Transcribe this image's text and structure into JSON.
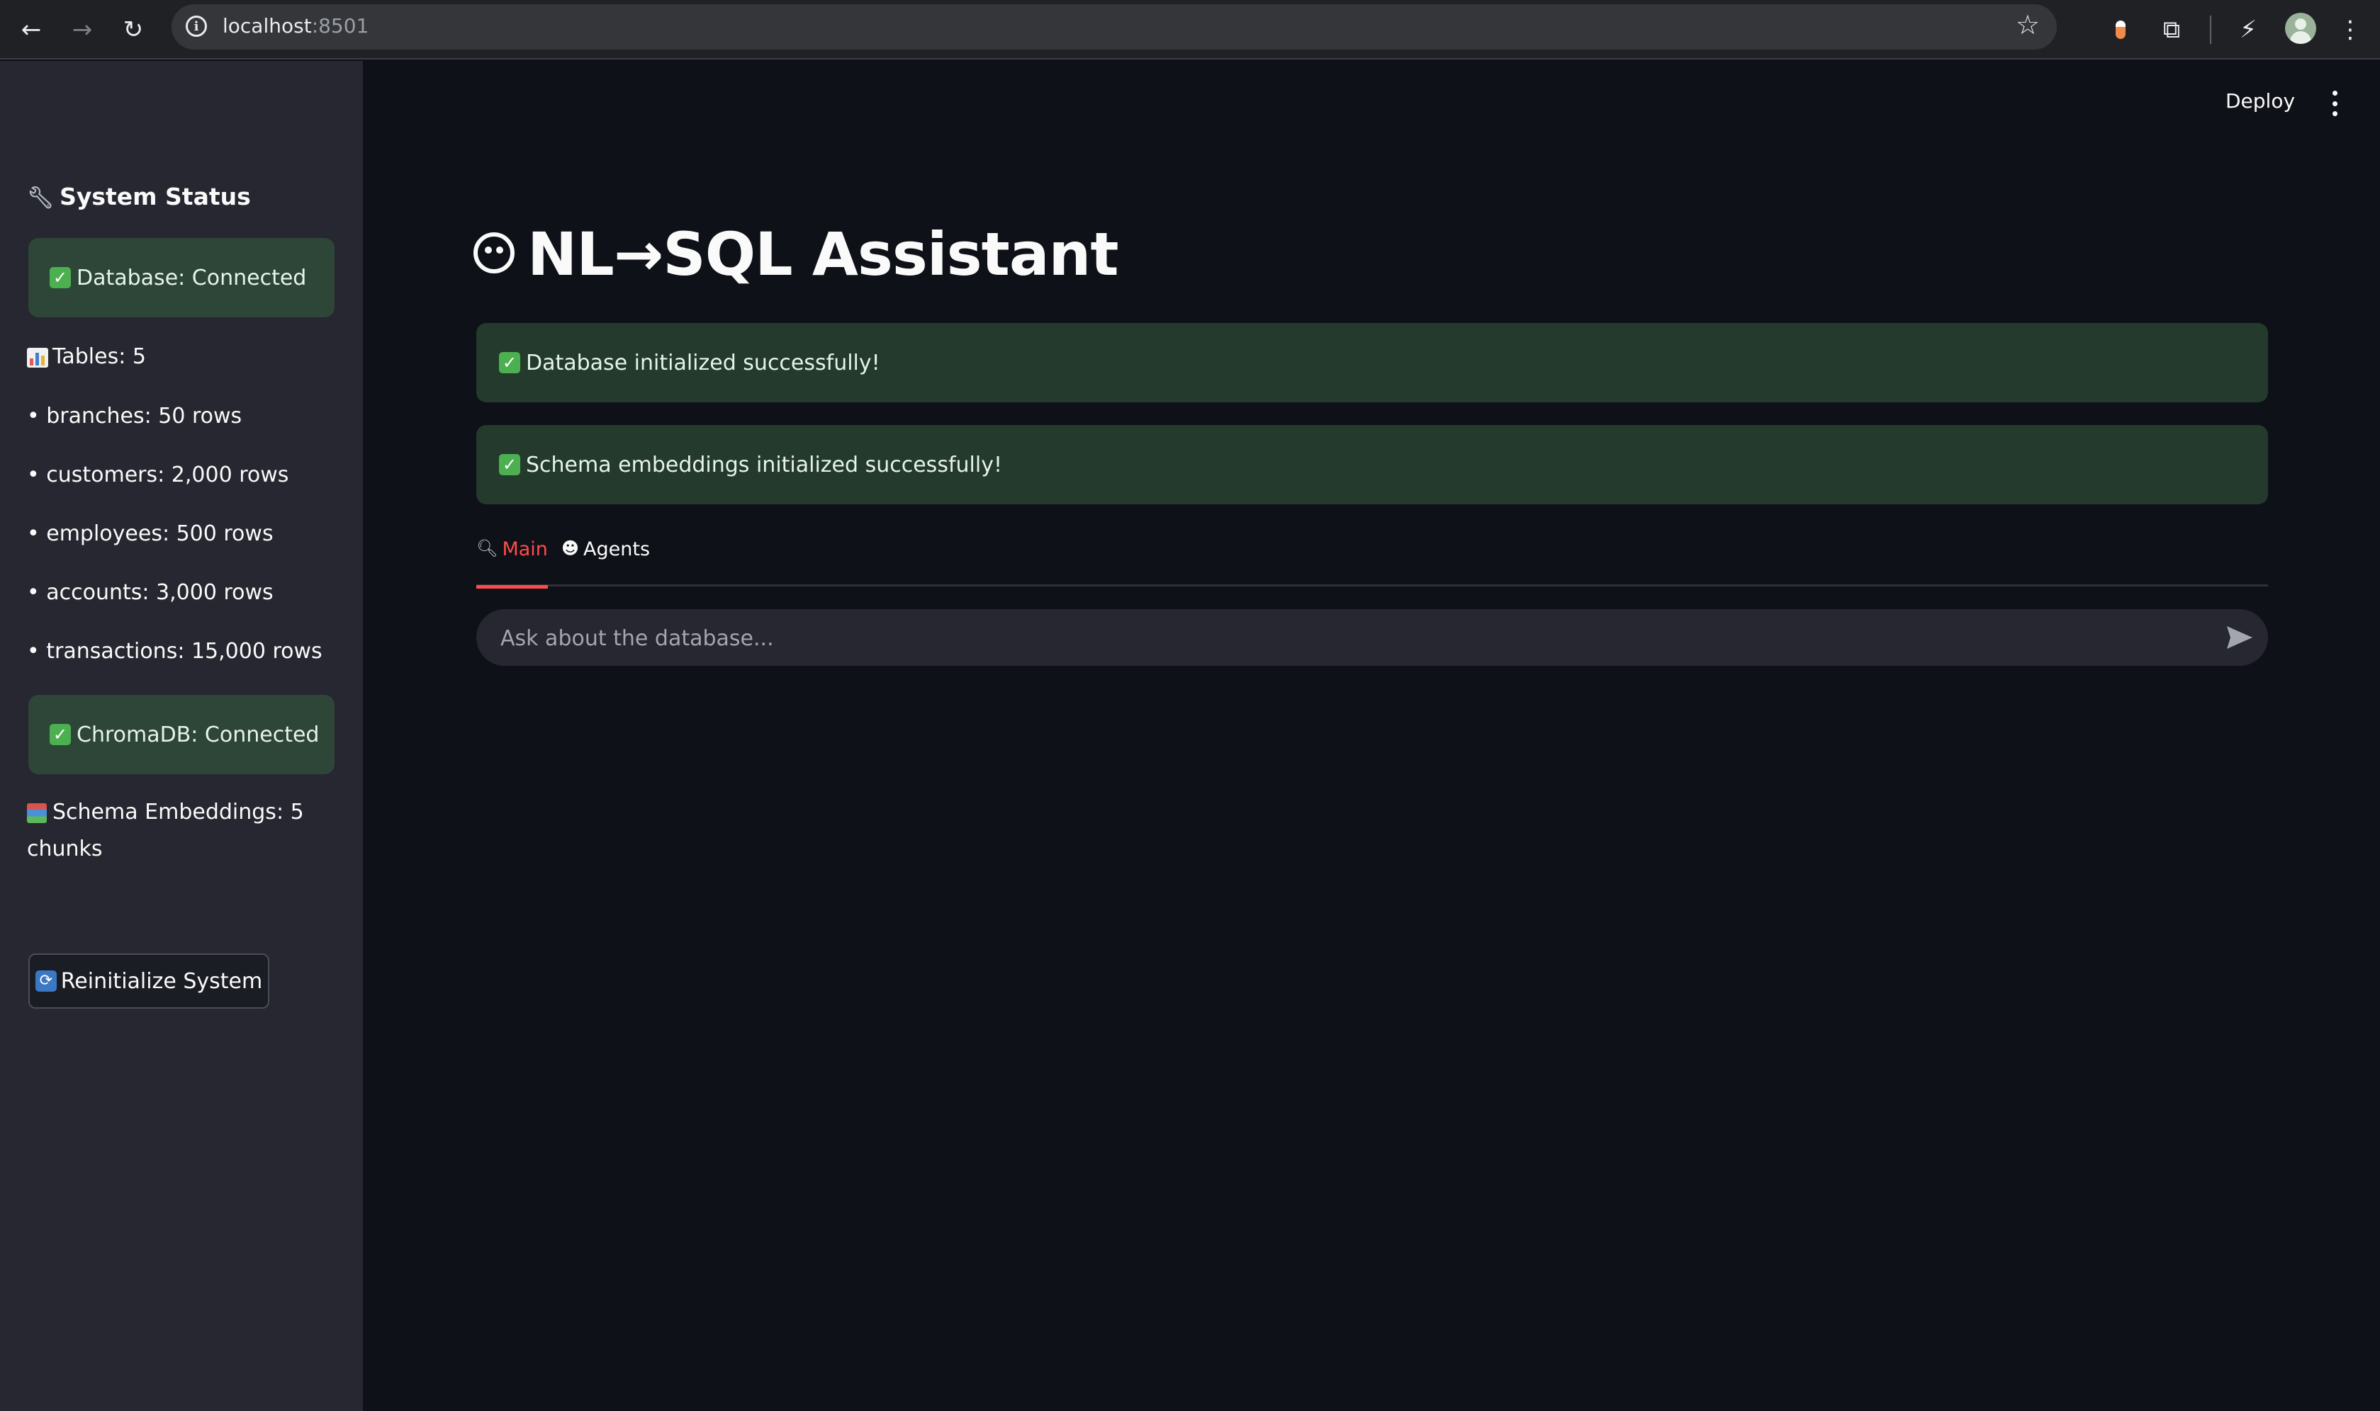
{
  "browser": {
    "url_host": "localhost",
    "url_port": ":8501"
  },
  "header": {
    "deploy_label": "Deploy"
  },
  "sidebar": {
    "heading": "System Status",
    "database_status": "Database: Connected",
    "tables_label": "Tables: 5",
    "table_rows": [
      "• branches: 50 rows",
      "• customers: 2,000 rows",
      "• employees: 500 rows",
      "• accounts: 3,000 rows",
      "• transactions: 15,000 rows"
    ],
    "chroma_status": "ChromaDB: Connected",
    "embeddings_label": "Schema Embeddings: 5 chunks",
    "reinit_button": "Reinitialize System"
  },
  "main": {
    "title": "NL→SQL Assistant",
    "alerts": [
      "Database initialized successfully!",
      "Schema embeddings initialized successfully!"
    ],
    "tabs": [
      {
        "label": "Main",
        "icon": "magnifier-icon",
        "active": true
      },
      {
        "label": "Agents",
        "icon": "robot-icon",
        "active": false
      }
    ],
    "chat_placeholder": "Ask about the database..."
  },
  "colors": {
    "background": "#0e1117",
    "sidebar": "#262730",
    "success_bg": "#233a2c",
    "accent": "#ff4b4b"
  }
}
